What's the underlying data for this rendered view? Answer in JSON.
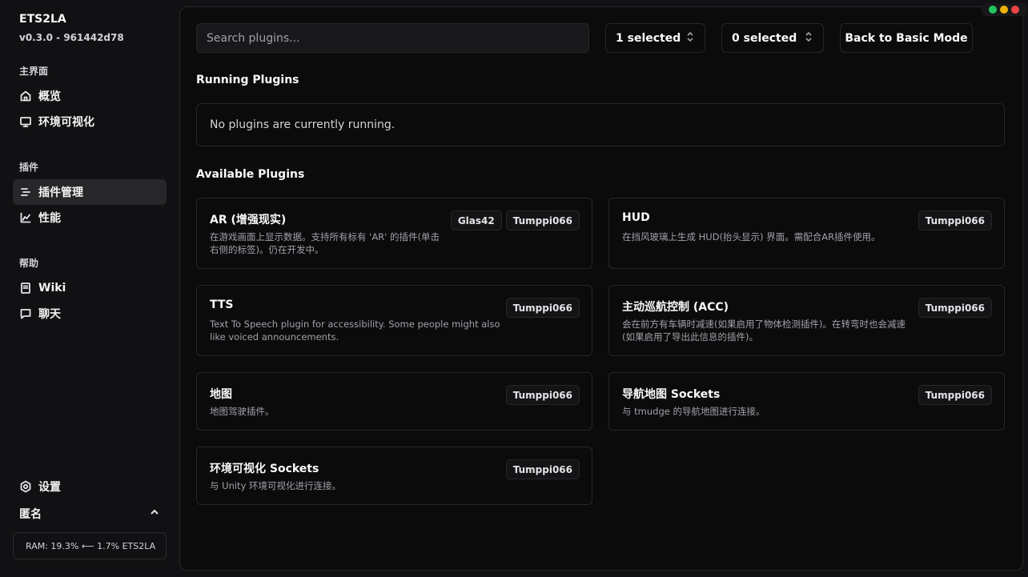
{
  "app": {
    "title": "ETS2LA",
    "version": "v0.3.0 - 961442d78"
  },
  "sidebar": {
    "sections": [
      {
        "label": "主界面",
        "items": [
          {
            "label": "概览",
            "icon": "home-icon"
          },
          {
            "label": "环境可视化",
            "icon": "monitor-icon"
          }
        ]
      },
      {
        "label": "插件",
        "items": [
          {
            "label": "插件管理",
            "icon": "list-icon",
            "active": true
          },
          {
            "label": "性能",
            "icon": "chart-icon"
          }
        ]
      },
      {
        "label": "帮助",
        "items": [
          {
            "label": "Wiki",
            "icon": "book-icon"
          },
          {
            "label": "聊天",
            "icon": "chat-icon"
          }
        ]
      }
    ],
    "settings_label": "设置",
    "user_label": "匿名",
    "ram_status": "RAM: 19.3% ⟵ 1.7% ETS2LA"
  },
  "window_controls": {
    "colors": [
      "#22c55e",
      "#eab308",
      "#ef4444"
    ]
  },
  "toolbar": {
    "search_placeholder": "Search plugins...",
    "filter1": "1 selected",
    "filter2": "0 selected",
    "back_label": "Back to Basic Mode"
  },
  "running": {
    "heading": "Running Plugins",
    "empty_text": "No plugins are currently running."
  },
  "available": {
    "heading": "Available Plugins",
    "plugins": [
      {
        "title": "AR (增强现实)",
        "desc_lines": [
          "在游戏画面上显示数据。支持所有标有 'AR' 的插件(单击",
          "右侧的标签)。仍在开发中。"
        ],
        "tags": [
          "Glas42",
          "Tumppi066"
        ]
      },
      {
        "title": "HUD",
        "desc_lines": [
          "在挡风玻璃上生成 HUD(抬头显示) 界面。需配合AR插件使用。"
        ],
        "tags": [
          "Tumppi066"
        ]
      },
      {
        "title": "TTS",
        "desc_lines": [
          "Text To Speech plugin for accessibility. Some people might also",
          "like voiced announcements."
        ],
        "tags": [
          "Tumppi066"
        ]
      },
      {
        "title": "主动巡航控制 (ACC)",
        "desc_lines": [
          "会在前方有车辆时减速(如果启用了物体检测插件)。在转弯时也会减速",
          "(如果启用了导出此信息的插件)。"
        ],
        "tags": [
          "Tumppi066"
        ]
      },
      {
        "title": "地图",
        "desc_lines": [
          "地图驾驶插件。"
        ],
        "tags": [
          "Tumppi066"
        ]
      },
      {
        "title": "导航地图 Sockets",
        "desc_lines": [
          "与 tmudge 的导航地图进行连接。"
        ],
        "tags": [
          "Tumppi066"
        ]
      },
      {
        "title": "环境可视化 Sockets",
        "desc_lines": [
          "与 Unity 环境可视化进行连接。"
        ],
        "tags": [
          "Tumppi066"
        ]
      }
    ]
  }
}
